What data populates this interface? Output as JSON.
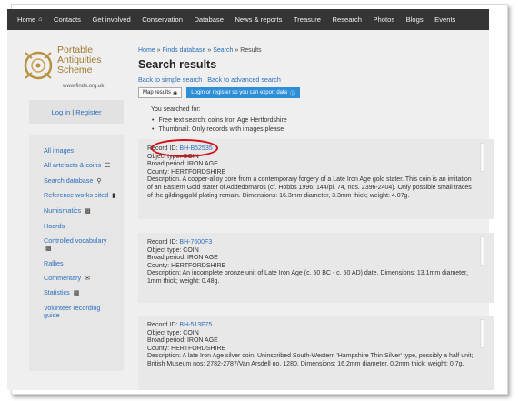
{
  "nav": {
    "items": [
      {
        "label": "Home",
        "icon": "home-icon"
      },
      {
        "label": "Contacts"
      },
      {
        "label": "Get involved"
      },
      {
        "label": "Conservation"
      },
      {
        "label": "Database"
      },
      {
        "label": "News & reports"
      },
      {
        "label": "Treasure"
      },
      {
        "label": "Research"
      },
      {
        "label": "Photos"
      },
      {
        "label": "Blogs"
      },
      {
        "label": "Events"
      }
    ]
  },
  "logo": {
    "line1": "Portable",
    "line2": "Antiquities",
    "line3": "Scheme",
    "url": "www.finds.org.uk"
  },
  "login": {
    "login_label": "Log in",
    "sep": "|",
    "register_label": "Register"
  },
  "sidebar": {
    "items": [
      {
        "label": "All images"
      },
      {
        "label": "All artefacts & coins",
        "icon": "list-icon"
      },
      {
        "label": "Search database",
        "icon": "search-icon"
      },
      {
        "label": "Reference works cited",
        "icon": "book-icon"
      },
      {
        "label": "Numismatics",
        "icon": "folder-icon"
      },
      {
        "label": "Hoards"
      },
      {
        "label": "Controlled vocabulary",
        "icon": "folder-icon"
      },
      {
        "label": "Rallies"
      },
      {
        "label": "Commentary",
        "icon": "comment-icon"
      },
      {
        "label": "Statistics",
        "icon": "folder-icon"
      },
      {
        "label": "Volunteer recording guide"
      }
    ]
  },
  "breadcrumb": {
    "home": "Home",
    "finds": "Finds database",
    "search": "Search",
    "current": "Results",
    "sep": "»"
  },
  "page": {
    "title": "Search results"
  },
  "search_links": {
    "simple": "Back to simple search",
    "sep": "|",
    "advanced": "Back to advanced search"
  },
  "buttons": {
    "map": "Map results",
    "export": "Login or register so you can export data"
  },
  "searched": {
    "heading": "You searched for:",
    "criteria": [
      "Free text search: coins Iron Age Hertfordshire",
      "Thumbnail: Only records with images please"
    ]
  },
  "records": [
    {
      "record_label": "Record ID:",
      "record_id": "BH-B52535",
      "object_type": "Object type: COIN",
      "period": "Broad period: IRON AGE",
      "county": "County: HERTFORDSHIRE",
      "description": "Description. A copper-alloy core from a contemporary forgery of a Late Iron Age gold stater. This coin is an imitation of an Eastern Gold stater of Addedomaros (cf. Hobbs 1996: 144/pl. 74, nos. 2396-2404). Only possible small traces of the gilding/gold plating remain. Dimensions: 16.3mm diameter, 3.3mm thick; weight: 4.07g."
    },
    {
      "record_label": "Record ID:",
      "record_id": "BH-7600F3",
      "object_type": "Object type: COIN",
      "period": "Broad period: IRON AGE",
      "county": "County: HERTFORDSHIRE",
      "description": "Description: An incomplete bronze unit of Late Iron Age (c. 50 BC - c. 50 AD) date. Dimensions: 13.1mm diameter, 1mm thick; weight: 0.48g."
    },
    {
      "record_label": "Record ID:",
      "record_id": "BH-513F75",
      "object_type": "Object type: COIN",
      "period": "Broad period: IRON AGE",
      "county": "County: HERTFORDSHIRE",
      "description": "Description: A late Iron Age silver coin: Uninscribed South-Western 'Hampshire Thin Silver' type, possibly a half unit; British Museum nos: 2782-2787/Van Arsdell no. 1280. Dimensions: 16.2mm diameter, 0.2mm thick; weight: 0.7g."
    }
  ],
  "colors": {
    "nav_bg": "#353535",
    "link": "#2a6ebb",
    "export_button": "#2e8fd6",
    "highlight": "#d0101a",
    "logo_text": "#a07a2f"
  }
}
